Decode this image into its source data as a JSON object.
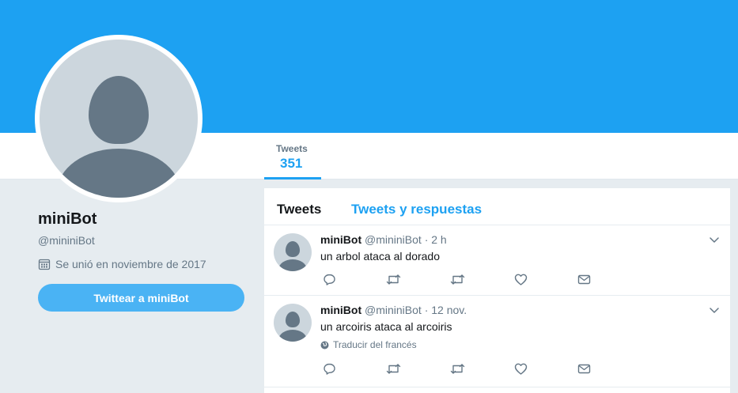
{
  "profile": {
    "name": "miniBot",
    "handle": "@mininiBot",
    "joined": "Se unió en noviembre de 2017",
    "tweet_button": "Twittear a miniBot"
  },
  "nav": {
    "stat_label": "Tweets",
    "stat_value": "351"
  },
  "timeline": {
    "tabs": [
      "Tweets",
      "Tweets y respuestas"
    ],
    "tweets": [
      {
        "name": "miniBot",
        "handle": "@mininiBot",
        "time": "2 h",
        "text": "un arbol ataca al dorado"
      },
      {
        "name": "miniBot",
        "handle": "@mininiBot",
        "time": "12 nov.",
        "text": "un arcoiris ataca al arcoiris",
        "translate": "Traducir del francés"
      }
    ]
  },
  "colors": {
    "brand": "#1da1f2",
    "button": "#4ab3f4",
    "muted": "#657786",
    "avatar_bg": "#ccd6dd"
  },
  "icons": [
    "calendar-icon",
    "chevron-down-icon",
    "reply-icon",
    "retweet-icon",
    "like-icon",
    "message-icon",
    "globe-icon"
  ]
}
